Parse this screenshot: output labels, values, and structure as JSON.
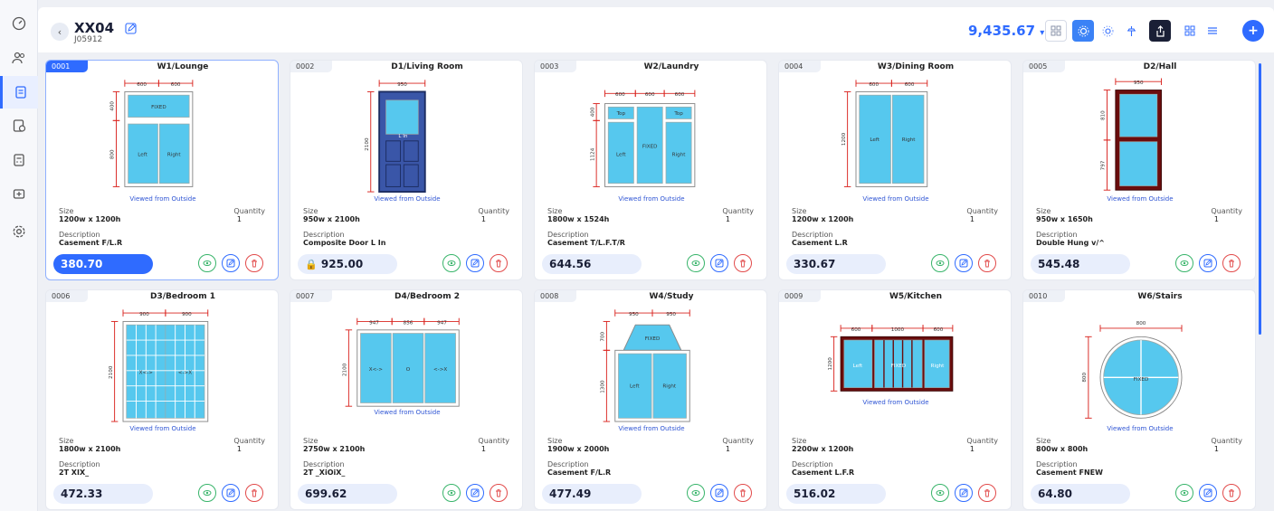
{
  "header": {
    "title": "XX04",
    "subtitle": "J05912",
    "total": "9,435.67",
    "caption": "Viewed from Outside"
  },
  "labels": {
    "size": "Size",
    "quantity": "Quantity",
    "description": "Description"
  },
  "colors": {
    "accent": "#2f6bff",
    "frame": "#d9241f",
    "glass": "#56c8ee",
    "view": "#38b46a",
    "delete": "#e24a4a"
  },
  "sidebar": {
    "items": [
      {
        "icon": "dashboard-icon"
      },
      {
        "icon": "users-icon"
      },
      {
        "icon": "quote-icon",
        "active": true
      },
      {
        "icon": "orders-icon"
      },
      {
        "icon": "calculator-icon"
      },
      {
        "icon": "add-cart-icon"
      },
      {
        "icon": "settings-icon"
      }
    ]
  },
  "items": [
    {
      "id": "0001",
      "name": "W1/Lounge",
      "size": "1200w x 1200h",
      "quantity": "1",
      "description": "Casement F/L.R",
      "price": "380.70",
      "selected": true,
      "type": "casement-top"
    },
    {
      "id": "0002",
      "name": "D1/Living Room",
      "size": "950w x 2100h",
      "quantity": "1",
      "description": "Composite Door L In",
      "price": "925.00",
      "locked": true,
      "type": "door"
    },
    {
      "id": "0003",
      "name": "W2/Laundry",
      "size": "1800w x 1524h",
      "quantity": "1",
      "description": "Casement T/L.F.T/R",
      "price": "644.56",
      "type": "three"
    },
    {
      "id": "0004",
      "name": "W3/Dining Room",
      "size": "1200w x 1200h",
      "quantity": "1",
      "description": "Casement L.R",
      "price": "330.67",
      "type": "two"
    },
    {
      "id": "0005",
      "name": "D2/Hall",
      "size": "950w x 1650h",
      "quantity": "1",
      "description": "Double Hung v/^",
      "price": "545.48",
      "type": "hung"
    },
    {
      "id": "0006",
      "name": "D3/Bedroom 1",
      "size": "1800w x 2100h",
      "quantity": "1",
      "description": "2T XIX_",
      "price": "472.33",
      "type": "slider-grid"
    },
    {
      "id": "0007",
      "name": "D4/Bedroom 2",
      "size": "2750w x 2100h",
      "quantity": "1",
      "description": "2T _XiOiX_",
      "price": "699.62",
      "type": "slider3"
    },
    {
      "id": "0008",
      "name": "W4/Study",
      "size": "1900w x 2000h",
      "quantity": "1",
      "description": "Casement F/L.R",
      "price": "477.49",
      "type": "gable"
    },
    {
      "id": "0009",
      "name": "W5/Kitchen",
      "size": "2200w x 1200h",
      "quantity": "1",
      "description": "Casement L.F.R",
      "price": "516.02",
      "type": "kitchen"
    },
    {
      "id": "0010",
      "name": "W6/Stairs",
      "size": "800w x 800h",
      "quantity": "1",
      "description": "Casement FNEW",
      "price": "64.80",
      "type": "round"
    }
  ],
  "drawing_text": {
    "0001": [
      "600",
      "600",
      "400",
      "800",
      "FIXED",
      "Left",
      "Right"
    ],
    "0002": [
      "950",
      "2100",
      "L In"
    ],
    "0003": [
      "600",
      "600",
      "600",
      "400",
      "1124",
      "Top",
      "Top",
      "FIXED",
      "Left",
      "Right"
    ],
    "0004": [
      "600",
      "600",
      "1200",
      "Left",
      "Right"
    ],
    "0005": [
      "950",
      "810",
      "797"
    ],
    "0006": [
      "900",
      "900",
      "2100",
      "X<->",
      "<->X"
    ],
    "0007": [
      "947",
      "856",
      "947",
      "2100",
      "X<->",
      "O",
      "<->X"
    ],
    "0008": [
      "950",
      "950",
      "700",
      "1300",
      "FIXED",
      "Left",
      "Right"
    ],
    "0009": [
      "600",
      "1000",
      "600",
      "1200",
      "Left",
      "FIXED",
      "Right"
    ],
    "0010": [
      "800",
      "800",
      "FIXED"
    ]
  }
}
